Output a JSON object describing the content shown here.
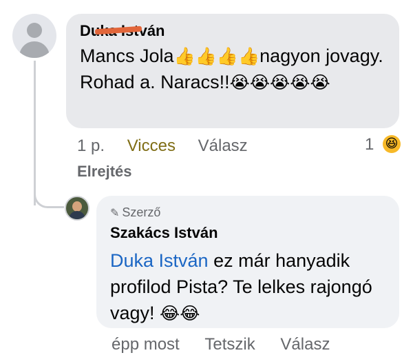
{
  "comment1": {
    "author": "Duka István",
    "text_before": "Mancs Jola",
    "emoji_thumbs": "👍👍👍👍",
    "text_middle": "nagyon jovagy. Rohad a. Naracs!!",
    "emoji_cry": "😭😭😭😭😭",
    "time": "1 p.",
    "reaction_label": "Vicces",
    "reply_label": "Válasz",
    "reaction_count": "1",
    "reaction_icon": "😆",
    "hide_label": "Elrejtés"
  },
  "comment2": {
    "badge": "Szerző",
    "author": "Szakács István",
    "mention": "Duka István",
    "text": " ez már hanyadik profilod Pista? Te lelkes rajongó vagy! ",
    "emoji": "😂😂",
    "time": "épp most",
    "like_label": "Tetszik",
    "reply_label": "Válasz"
  }
}
